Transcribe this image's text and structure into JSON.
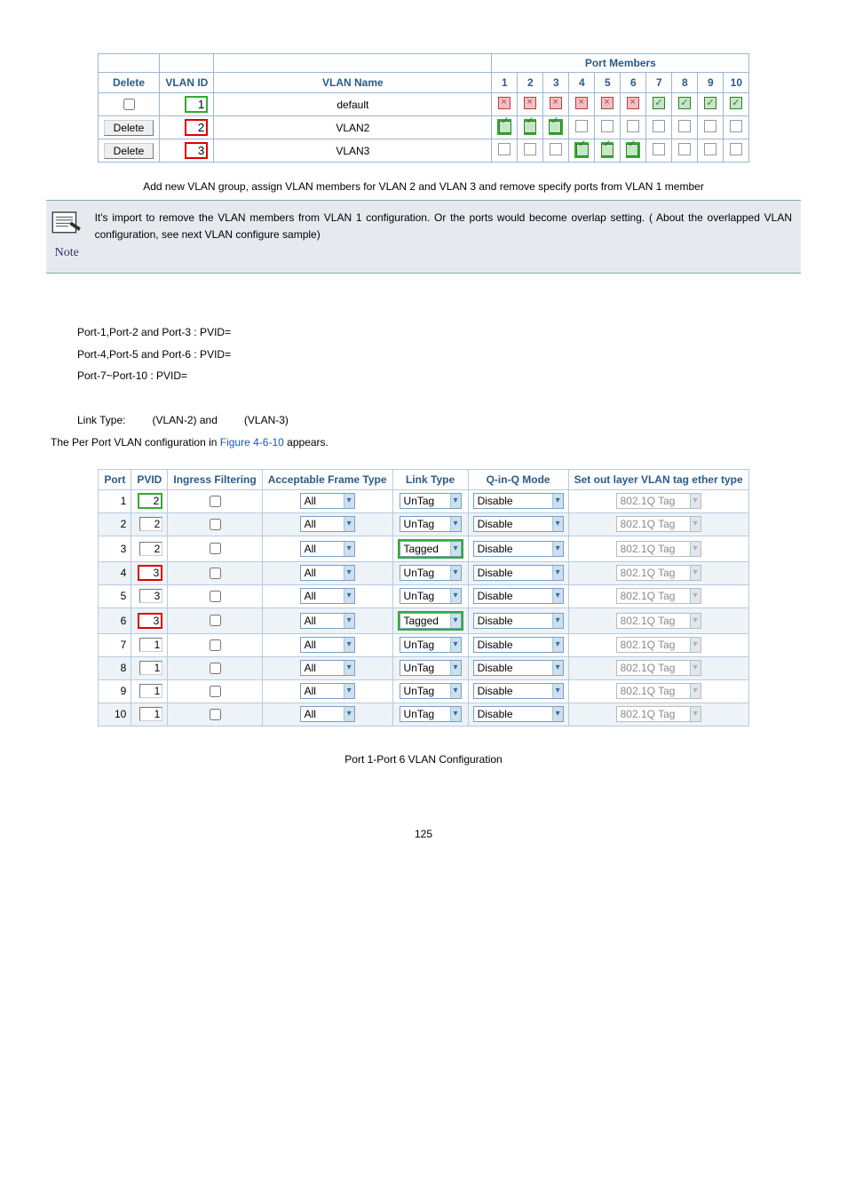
{
  "vlanTable": {
    "headerTitle": "Port Members",
    "cols": [
      "Delete",
      "VLAN ID",
      "VLAN Name"
    ],
    "portNums": [
      "1",
      "2",
      "3",
      "4",
      "5",
      "6",
      "7",
      "8",
      "9",
      "10"
    ],
    "rows": [
      {
        "delete": null,
        "id": "1",
        "name": "default",
        "members": [
          "x",
          "x",
          "x",
          "x",
          "x",
          "x",
          "g",
          "g",
          "g",
          "g"
        ],
        "highlight": "green"
      },
      {
        "delete": "Delete",
        "id": "2",
        "name": "VLAN2",
        "members": [
          "g",
          "g",
          "g",
          "e",
          "e",
          "e",
          "e",
          "e",
          "e",
          "e"
        ],
        "highlight": "red",
        "groupGreen123": true
      },
      {
        "delete": "Delete",
        "id": "3",
        "name": "VLAN3",
        "members": [
          "e",
          "e",
          "e",
          "g",
          "g",
          "g",
          "e",
          "e",
          "e",
          "e"
        ],
        "highlight": "red",
        "groupGreen456": true
      }
    ]
  },
  "captions": {
    "fig1": "Add new VLAN group, assign VLAN members for VLAN 2 and VLAN 3 and remove specify ports from VLAN 1 member",
    "fig2": "Port 1-Port 6 VLAN Configuration"
  },
  "note": {
    "label": "Note",
    "text": "It's import to remove the VLAN members from VLAN 1 configuration. Or the ports would become overlap setting. ( About the overlapped VLAN configuration, see next VLAN configure sample)"
  },
  "body": {
    "l1": "Port-1,Port-2 and Port-3 : PVID=",
    "l2": "Port-4,Port-5 and Port-6 : PVID=",
    "l3": "Port-7~Port-10 : PVID=",
    "l4a": "Link Type:",
    "l4b": "(VLAN-2) and",
    "l4c": "(VLAN-3)",
    "l5a": "The Per Port VLAN configuration in ",
    "l5link": "Figure 4-6-10",
    "l5b": " appears."
  },
  "portConfig": {
    "headers": [
      "Port",
      "PVID",
      "Ingress Filtering",
      "Acceptable Frame Type",
      "Link Type",
      "Q-in-Q Mode",
      "Set out layer VLAN tag ether type"
    ],
    "rows": [
      {
        "port": "1",
        "pvid": "2",
        "pvidClass": "pvid-green",
        "chk": false,
        "aft": "All",
        "link": "UnTag",
        "linkGreen": false,
        "qmode": "Disable",
        "eth": "802.1Q Tag",
        "alt": false
      },
      {
        "port": "2",
        "pvid": "2",
        "pvidClass": "pvid-plain",
        "chk": false,
        "aft": "All",
        "link": "UnTag",
        "linkGreen": false,
        "qmode": "Disable",
        "eth": "802.1Q Tag",
        "alt": true
      },
      {
        "port": "3",
        "pvid": "2",
        "pvidClass": "pvid-plain",
        "chk": false,
        "aft": "All",
        "link": "Tagged",
        "linkGreen": true,
        "qmode": "Disable",
        "eth": "802.1Q Tag",
        "alt": false
      },
      {
        "port": "4",
        "pvid": "3",
        "pvidClass": "pvid-red",
        "chk": false,
        "aft": "All",
        "link": "UnTag",
        "linkGreen": false,
        "qmode": "Disable",
        "eth": "802.1Q Tag",
        "alt": true
      },
      {
        "port": "5",
        "pvid": "3",
        "pvidClass": "pvid-plain",
        "chk": false,
        "aft": "All",
        "link": "UnTag",
        "linkGreen": false,
        "qmode": "Disable",
        "eth": "802.1Q Tag",
        "alt": false
      },
      {
        "port": "6",
        "pvid": "3",
        "pvidClass": "pvid-red",
        "chk": false,
        "aft": "All",
        "link": "Tagged",
        "linkGreen": true,
        "qmode": "Disable",
        "eth": "802.1Q Tag",
        "alt": true
      },
      {
        "port": "7",
        "pvid": "1",
        "pvidClass": "pvid-plain",
        "chk": false,
        "aft": "All",
        "link": "UnTag",
        "linkGreen": false,
        "qmode": "Disable",
        "eth": "802.1Q Tag",
        "alt": false
      },
      {
        "port": "8",
        "pvid": "1",
        "pvidClass": "pvid-plain",
        "chk": false,
        "aft": "All",
        "link": "UnTag",
        "linkGreen": false,
        "qmode": "Disable",
        "eth": "802.1Q Tag",
        "alt": true
      },
      {
        "port": "9",
        "pvid": "1",
        "pvidClass": "pvid-plain",
        "chk": false,
        "aft": "All",
        "link": "UnTag",
        "linkGreen": false,
        "qmode": "Disable",
        "eth": "802.1Q Tag",
        "alt": false
      },
      {
        "port": "10",
        "pvid": "1",
        "pvidClass": "pvid-plain",
        "chk": false,
        "aft": "All",
        "link": "UnTag",
        "linkGreen": false,
        "qmode": "Disable",
        "eth": "802.1Q Tag",
        "alt": true
      }
    ]
  },
  "pageNumber": "125"
}
